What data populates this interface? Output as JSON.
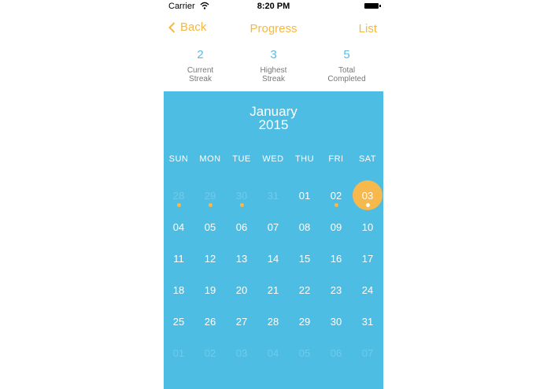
{
  "status_bar": {
    "carrier": "Carrier",
    "time": "8:20 PM"
  },
  "nav": {
    "back": "Back",
    "title": "Progress",
    "list": "List"
  },
  "stats": [
    {
      "value": "2",
      "label1": "Current",
      "label2": "Streak"
    },
    {
      "value": "3",
      "label1": "Highest",
      "label2": "Streak"
    },
    {
      "value": "5",
      "label1": "Total",
      "label2": "Completed"
    }
  ],
  "calendar": {
    "month": "January",
    "year": "2015",
    "weekdays": [
      "SUN",
      "MON",
      "TUE",
      "WED",
      "THU",
      "FRI",
      "SAT"
    ],
    "days": [
      {
        "label": "28",
        "outside": true,
        "done": true
      },
      {
        "label": "29",
        "outside": true,
        "done": true
      },
      {
        "label": "30",
        "outside": true,
        "done": true
      },
      {
        "label": "31",
        "outside": true,
        "done": false
      },
      {
        "label": "01",
        "outside": false,
        "done": false
      },
      {
        "label": "02",
        "outside": false,
        "done": true
      },
      {
        "label": "03",
        "outside": false,
        "done": true,
        "selected": true
      },
      {
        "label": "04",
        "outside": false,
        "done": false
      },
      {
        "label": "05",
        "outside": false,
        "done": false
      },
      {
        "label": "06",
        "outside": false,
        "done": false
      },
      {
        "label": "07",
        "outside": false,
        "done": false
      },
      {
        "label": "08",
        "outside": false,
        "done": false
      },
      {
        "label": "09",
        "outside": false,
        "done": false
      },
      {
        "label": "10",
        "outside": false,
        "done": false
      },
      {
        "label": "11",
        "outside": false,
        "done": false
      },
      {
        "label": "12",
        "outside": false,
        "done": false
      },
      {
        "label": "13",
        "outside": false,
        "done": false
      },
      {
        "label": "14",
        "outside": false,
        "done": false
      },
      {
        "label": "15",
        "outside": false,
        "done": false
      },
      {
        "label": "16",
        "outside": false,
        "done": false
      },
      {
        "label": "17",
        "outside": false,
        "done": false
      },
      {
        "label": "18",
        "outside": false,
        "done": false
      },
      {
        "label": "19",
        "outside": false,
        "done": false
      },
      {
        "label": "20",
        "outside": false,
        "done": false
      },
      {
        "label": "21",
        "outside": false,
        "done": false
      },
      {
        "label": "22",
        "outside": false,
        "done": false
      },
      {
        "label": "23",
        "outside": false,
        "done": false
      },
      {
        "label": "24",
        "outside": false,
        "done": false
      },
      {
        "label": "25",
        "outside": false,
        "done": false
      },
      {
        "label": "26",
        "outside": false,
        "done": false
      },
      {
        "label": "27",
        "outside": false,
        "done": false
      },
      {
        "label": "28",
        "outside": false,
        "done": false
      },
      {
        "label": "29",
        "outside": false,
        "done": false
      },
      {
        "label": "30",
        "outside": false,
        "done": false
      },
      {
        "label": "31",
        "outside": false,
        "done": false
      },
      {
        "label": "01",
        "outside": true,
        "done": false
      },
      {
        "label": "02",
        "outside": true,
        "done": false
      },
      {
        "label": "03",
        "outside": true,
        "done": false
      },
      {
        "label": "04",
        "outside": true,
        "done": false
      },
      {
        "label": "05",
        "outside": true,
        "done": false
      },
      {
        "label": "06",
        "outside": true,
        "done": false
      },
      {
        "label": "07",
        "outside": true,
        "done": false
      }
    ]
  },
  "icons": {
    "back": "chevron-left-icon",
    "wifi": "wifi-icon",
    "battery": "battery-icon"
  },
  "colors": {
    "accent": "#f5b840",
    "calendar_bg": "#4ebde3",
    "stat_number": "#5bb9e0"
  }
}
